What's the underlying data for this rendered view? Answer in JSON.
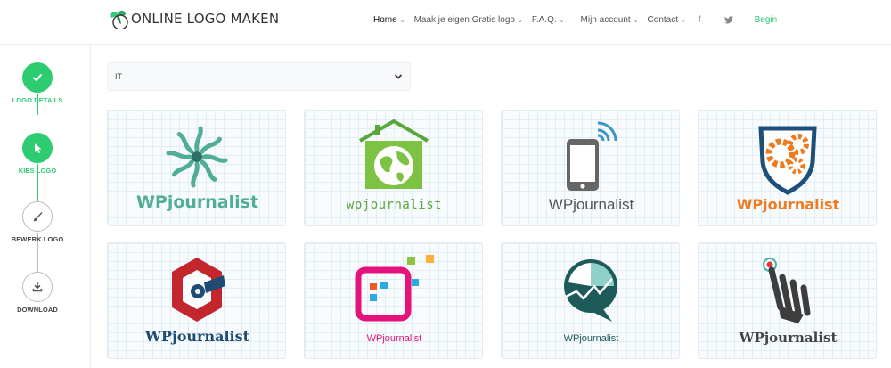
{
  "brand": {
    "name": "ONLINE LOGO MAKEN",
    "accent": "#2ecc71"
  },
  "nav": {
    "items": [
      {
        "label": "Home",
        "caret": true,
        "active": true
      },
      {
        "label": "Maak je eigen Gratis logo",
        "caret": true
      },
      {
        "label": "F.A.Q.",
        "caret": true
      },
      {
        "label": "Mijn account",
        "caret": true
      },
      {
        "label": "Contact",
        "caret": true
      }
    ],
    "social": [
      {
        "icon": "facebook-icon",
        "glyph": "f"
      },
      {
        "icon": "twitter-icon",
        "glyph": "🐦"
      }
    ],
    "cta": "Begin"
  },
  "steps": [
    {
      "label": "LOGO DETAILS",
      "status": "done",
      "icon": "check-icon"
    },
    {
      "label": "KIES LOGO",
      "status": "done",
      "icon": "cursor-icon"
    },
    {
      "label": "BEWERK LOGO",
      "status": "todo",
      "icon": "brush-icon"
    },
    {
      "label": "DOWNLOAD",
      "status": "todo",
      "icon": "download-icon"
    }
  ],
  "filter": {
    "selected": "IT"
  },
  "logos": [
    {
      "text": "WPjournalist",
      "color": "#4fae95",
      "icon": "pinwheel-icon"
    },
    {
      "text": "wpjournalist",
      "color": "#5aa63b",
      "icon": "house-globe-icon"
    },
    {
      "text": "WPjournalist",
      "color": "#555555",
      "icon": "smartphone-icon"
    },
    {
      "text": "WPjournalist",
      "color": "#ef7b1e",
      "icon": "shield-gear-icon"
    },
    {
      "text": "WPjournalist",
      "color": "#1f4a72",
      "icon": "hexagon-c-icon"
    },
    {
      "text": "WPjournalist",
      "color": "#e4127b",
      "icon": "app-squares-icon"
    },
    {
      "text": "WPjournalist",
      "color": "#1f5a5a",
      "icon": "chart-bubble-icon"
    },
    {
      "text": "WPjournalist",
      "color": "#444444",
      "icon": "hand-tap-icon"
    }
  ],
  "colors": {
    "green": "#2ecc71",
    "muted": "#bbbbbb"
  }
}
